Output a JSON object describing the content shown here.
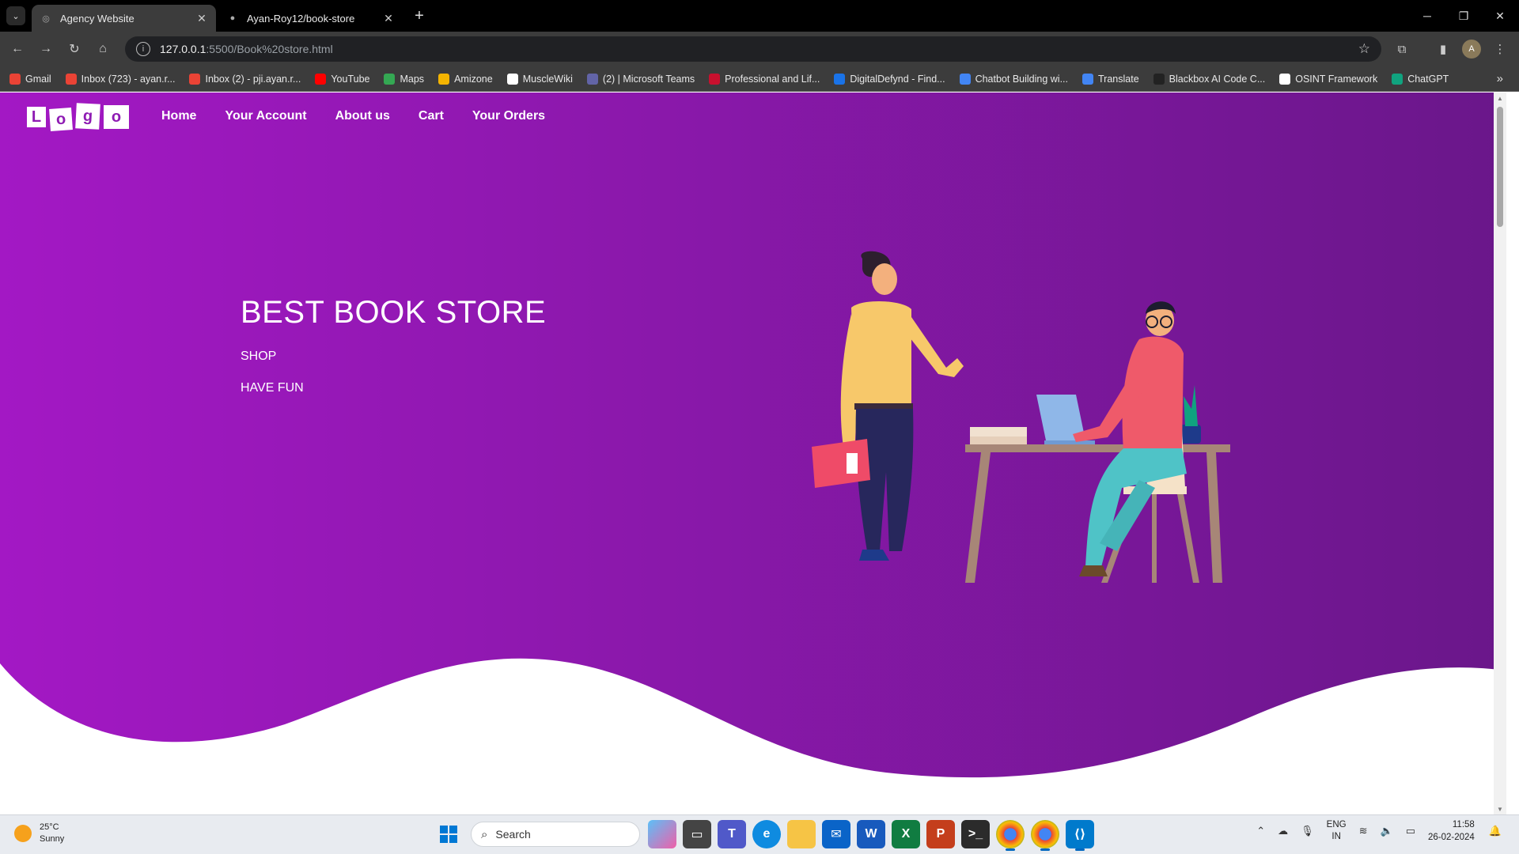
{
  "browser": {
    "tabs": [
      {
        "title": "Agency Website",
        "active": true
      },
      {
        "title": "Ayan-Roy12/book-store",
        "active": false
      }
    ],
    "url_host": "127.0.0.1",
    "url_path": ":5500/Book%20store.html",
    "bookmarks": [
      {
        "label": "Gmail",
        "color": "#ea4335",
        "icon": "gmail-icon"
      },
      {
        "label": "Inbox (723) - ayan.r...",
        "color": "#ea4335",
        "icon": "gmail-icon"
      },
      {
        "label": "Inbox (2) - pji.ayan.r...",
        "color": "#ea4335",
        "icon": "gmail-icon"
      },
      {
        "label": "YouTube",
        "color": "#ff0000",
        "icon": "youtube-icon"
      },
      {
        "label": "Maps",
        "color": "#34a853",
        "icon": "maps-icon"
      },
      {
        "label": "Amizone",
        "color": "#f4b400",
        "icon": "amizone-icon"
      },
      {
        "label": "MuscleWiki",
        "color": "#ffffff",
        "icon": "musclewiki-icon"
      },
      {
        "label": "(2) | Microsoft Teams",
        "color": "#6264a7",
        "icon": "teams-icon"
      },
      {
        "label": "Professional and Lif...",
        "color": "#c8102e",
        "icon": "harvard-icon"
      },
      {
        "label": "DigitalDefynd - Find...",
        "color": "#1a73e8",
        "icon": "digitaldefynd-icon"
      },
      {
        "label": "Chatbot Building wi...",
        "color": "#4285f4",
        "icon": "chatbot-icon"
      },
      {
        "label": "Translate",
        "color": "#4285f4",
        "icon": "translate-icon"
      },
      {
        "label": "Blackbox AI Code C...",
        "color": "#222222",
        "icon": "blackbox-icon"
      },
      {
        "label": "OSINT Framework",
        "color": "#ffffff",
        "icon": "osint-icon"
      },
      {
        "label": "ChatGPT",
        "color": "#10a37f",
        "icon": "chatgpt-icon"
      }
    ]
  },
  "page": {
    "logo_letters": [
      "L",
      "o",
      "g",
      "o"
    ],
    "nav": [
      "Home",
      "Your Account",
      "About us",
      "Cart",
      "Your Orders"
    ],
    "headline": "BEST BOOK STORE",
    "lines": [
      "SHOP",
      "HAVE FUN"
    ],
    "colors": {
      "gradient_left": "#a318c4",
      "gradient_right": "#6a178a"
    }
  },
  "taskbar": {
    "weather_temp": "25°C",
    "weather_desc": "Sunny",
    "search_placeholder": "Search",
    "lang_top": "ENG",
    "lang_bottom": "IN",
    "time": "11:58",
    "date": "26-02-2024"
  }
}
